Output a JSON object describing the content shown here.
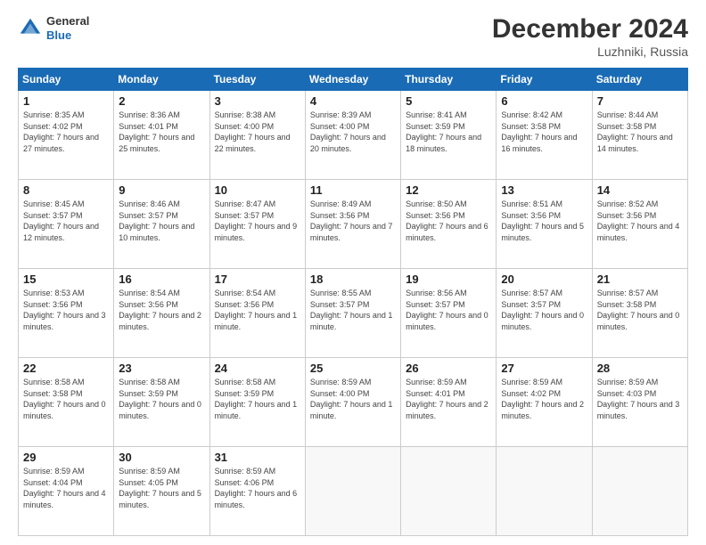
{
  "logo": {
    "general": "General",
    "blue": "Blue"
  },
  "header": {
    "month": "December 2024",
    "location": "Luzhniki, Russia"
  },
  "weekdays": [
    "Sunday",
    "Monday",
    "Tuesday",
    "Wednesday",
    "Thursday",
    "Friday",
    "Saturday"
  ],
  "weeks": [
    [
      {
        "day": 1,
        "sunrise": "Sunrise: 8:35 AM",
        "sunset": "Sunset: 4:02 PM",
        "daylight": "Daylight: 7 hours and 27 minutes."
      },
      {
        "day": 2,
        "sunrise": "Sunrise: 8:36 AM",
        "sunset": "Sunset: 4:01 PM",
        "daylight": "Daylight: 7 hours and 25 minutes."
      },
      {
        "day": 3,
        "sunrise": "Sunrise: 8:38 AM",
        "sunset": "Sunset: 4:00 PM",
        "daylight": "Daylight: 7 hours and 22 minutes."
      },
      {
        "day": 4,
        "sunrise": "Sunrise: 8:39 AM",
        "sunset": "Sunset: 4:00 PM",
        "daylight": "Daylight: 7 hours and 20 minutes."
      },
      {
        "day": 5,
        "sunrise": "Sunrise: 8:41 AM",
        "sunset": "Sunset: 3:59 PM",
        "daylight": "Daylight: 7 hours and 18 minutes."
      },
      {
        "day": 6,
        "sunrise": "Sunrise: 8:42 AM",
        "sunset": "Sunset: 3:58 PM",
        "daylight": "Daylight: 7 hours and 16 minutes."
      },
      {
        "day": 7,
        "sunrise": "Sunrise: 8:44 AM",
        "sunset": "Sunset: 3:58 PM",
        "daylight": "Daylight: 7 hours and 14 minutes."
      }
    ],
    [
      {
        "day": 8,
        "sunrise": "Sunrise: 8:45 AM",
        "sunset": "Sunset: 3:57 PM",
        "daylight": "Daylight: 7 hours and 12 minutes."
      },
      {
        "day": 9,
        "sunrise": "Sunrise: 8:46 AM",
        "sunset": "Sunset: 3:57 PM",
        "daylight": "Daylight: 7 hours and 10 minutes."
      },
      {
        "day": 10,
        "sunrise": "Sunrise: 8:47 AM",
        "sunset": "Sunset: 3:57 PM",
        "daylight": "Daylight: 7 hours and 9 minutes."
      },
      {
        "day": 11,
        "sunrise": "Sunrise: 8:49 AM",
        "sunset": "Sunset: 3:56 PM",
        "daylight": "Daylight: 7 hours and 7 minutes."
      },
      {
        "day": 12,
        "sunrise": "Sunrise: 8:50 AM",
        "sunset": "Sunset: 3:56 PM",
        "daylight": "Daylight: 7 hours and 6 minutes."
      },
      {
        "day": 13,
        "sunrise": "Sunrise: 8:51 AM",
        "sunset": "Sunset: 3:56 PM",
        "daylight": "Daylight: 7 hours and 5 minutes."
      },
      {
        "day": 14,
        "sunrise": "Sunrise: 8:52 AM",
        "sunset": "Sunset: 3:56 PM",
        "daylight": "Daylight: 7 hours and 4 minutes."
      }
    ],
    [
      {
        "day": 15,
        "sunrise": "Sunrise: 8:53 AM",
        "sunset": "Sunset: 3:56 PM",
        "daylight": "Daylight: 7 hours and 3 minutes."
      },
      {
        "day": 16,
        "sunrise": "Sunrise: 8:54 AM",
        "sunset": "Sunset: 3:56 PM",
        "daylight": "Daylight: 7 hours and 2 minutes."
      },
      {
        "day": 17,
        "sunrise": "Sunrise: 8:54 AM",
        "sunset": "Sunset: 3:56 PM",
        "daylight": "Daylight: 7 hours and 1 minute."
      },
      {
        "day": 18,
        "sunrise": "Sunrise: 8:55 AM",
        "sunset": "Sunset: 3:57 PM",
        "daylight": "Daylight: 7 hours and 1 minute."
      },
      {
        "day": 19,
        "sunrise": "Sunrise: 8:56 AM",
        "sunset": "Sunset: 3:57 PM",
        "daylight": "Daylight: 7 hours and 0 minutes."
      },
      {
        "day": 20,
        "sunrise": "Sunrise: 8:57 AM",
        "sunset": "Sunset: 3:57 PM",
        "daylight": "Daylight: 7 hours and 0 minutes."
      },
      {
        "day": 21,
        "sunrise": "Sunrise: 8:57 AM",
        "sunset": "Sunset: 3:58 PM",
        "daylight": "Daylight: 7 hours and 0 minutes."
      }
    ],
    [
      {
        "day": 22,
        "sunrise": "Sunrise: 8:58 AM",
        "sunset": "Sunset: 3:58 PM",
        "daylight": "Daylight: 7 hours and 0 minutes."
      },
      {
        "day": 23,
        "sunrise": "Sunrise: 8:58 AM",
        "sunset": "Sunset: 3:59 PM",
        "daylight": "Daylight: 7 hours and 0 minutes."
      },
      {
        "day": 24,
        "sunrise": "Sunrise: 8:58 AM",
        "sunset": "Sunset: 3:59 PM",
        "daylight": "Daylight: 7 hours and 1 minute."
      },
      {
        "day": 25,
        "sunrise": "Sunrise: 8:59 AM",
        "sunset": "Sunset: 4:00 PM",
        "daylight": "Daylight: 7 hours and 1 minute."
      },
      {
        "day": 26,
        "sunrise": "Sunrise: 8:59 AM",
        "sunset": "Sunset: 4:01 PM",
        "daylight": "Daylight: 7 hours and 2 minutes."
      },
      {
        "day": 27,
        "sunrise": "Sunrise: 8:59 AM",
        "sunset": "Sunset: 4:02 PM",
        "daylight": "Daylight: 7 hours and 2 minutes."
      },
      {
        "day": 28,
        "sunrise": "Sunrise: 8:59 AM",
        "sunset": "Sunset: 4:03 PM",
        "daylight": "Daylight: 7 hours and 3 minutes."
      }
    ],
    [
      {
        "day": 29,
        "sunrise": "Sunrise: 8:59 AM",
        "sunset": "Sunset: 4:04 PM",
        "daylight": "Daylight: 7 hours and 4 minutes."
      },
      {
        "day": 30,
        "sunrise": "Sunrise: 8:59 AM",
        "sunset": "Sunset: 4:05 PM",
        "daylight": "Daylight: 7 hours and 5 minutes."
      },
      {
        "day": 31,
        "sunrise": "Sunrise: 8:59 AM",
        "sunset": "Sunset: 4:06 PM",
        "daylight": "Daylight: 7 hours and 6 minutes."
      },
      null,
      null,
      null,
      null
    ]
  ]
}
